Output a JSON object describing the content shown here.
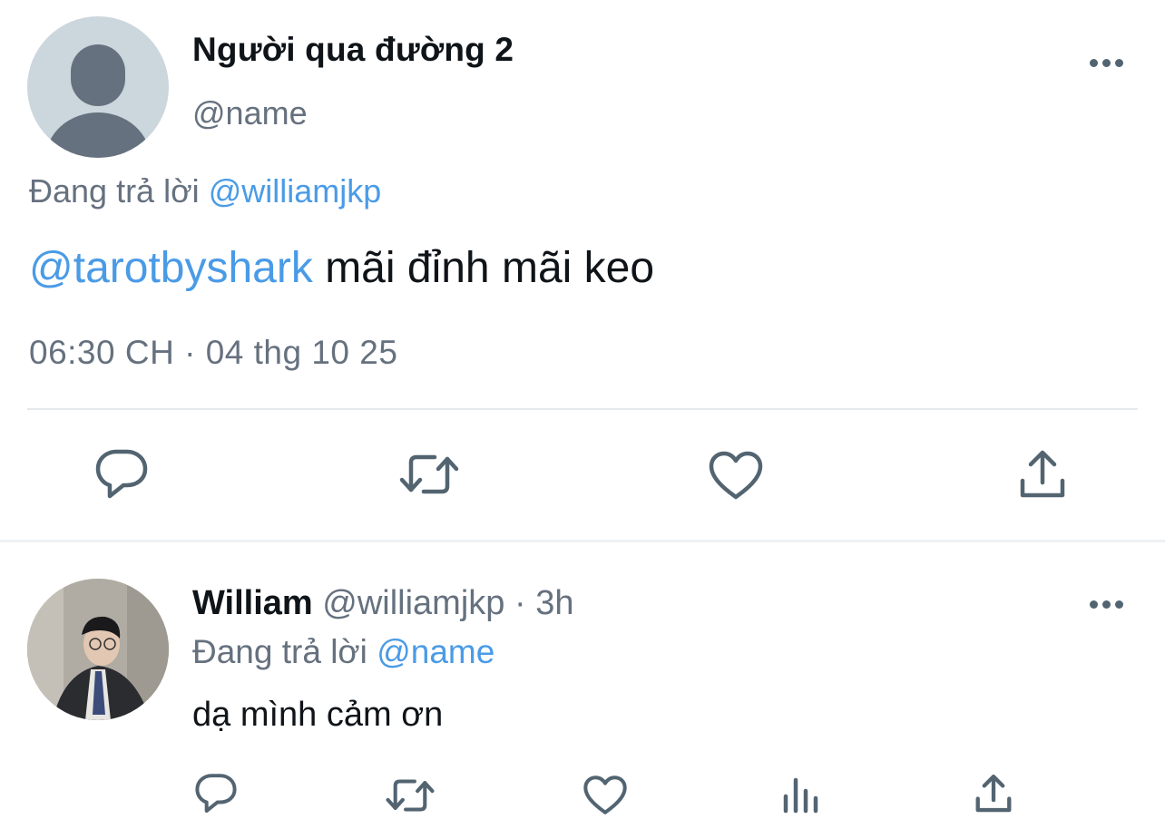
{
  "main_tweet": {
    "display_name": "Người qua đường 2",
    "handle": "@name",
    "replying_prefix": "Đang trả lời",
    "replying_to": "@williamjkp",
    "mention": "@tarotbyshark",
    "text": "mãi đỉnh mãi keo",
    "timestamp": "06:30 CH · 04 thg 10 25",
    "actions": [
      "reply-icon",
      "retweet-icon",
      "like-icon",
      "share-icon"
    ]
  },
  "reply_tweet": {
    "display_name": "William",
    "handle": "@williamjkp",
    "separator": "·",
    "time_ago": "3h",
    "replying_prefix": "Đang trả lời",
    "replying_to": "@name",
    "text": "dạ mình cảm ơn",
    "actions": [
      "reply-icon",
      "retweet-icon",
      "like-icon",
      "analytics-icon",
      "share-icon"
    ]
  },
  "colors": {
    "link": "#4a9be6",
    "muted": "#66717f",
    "text": "#0f1419",
    "icon": "#536471",
    "divider": "#e6e9ec",
    "avatar_placeholder": "#ccd6dd"
  }
}
